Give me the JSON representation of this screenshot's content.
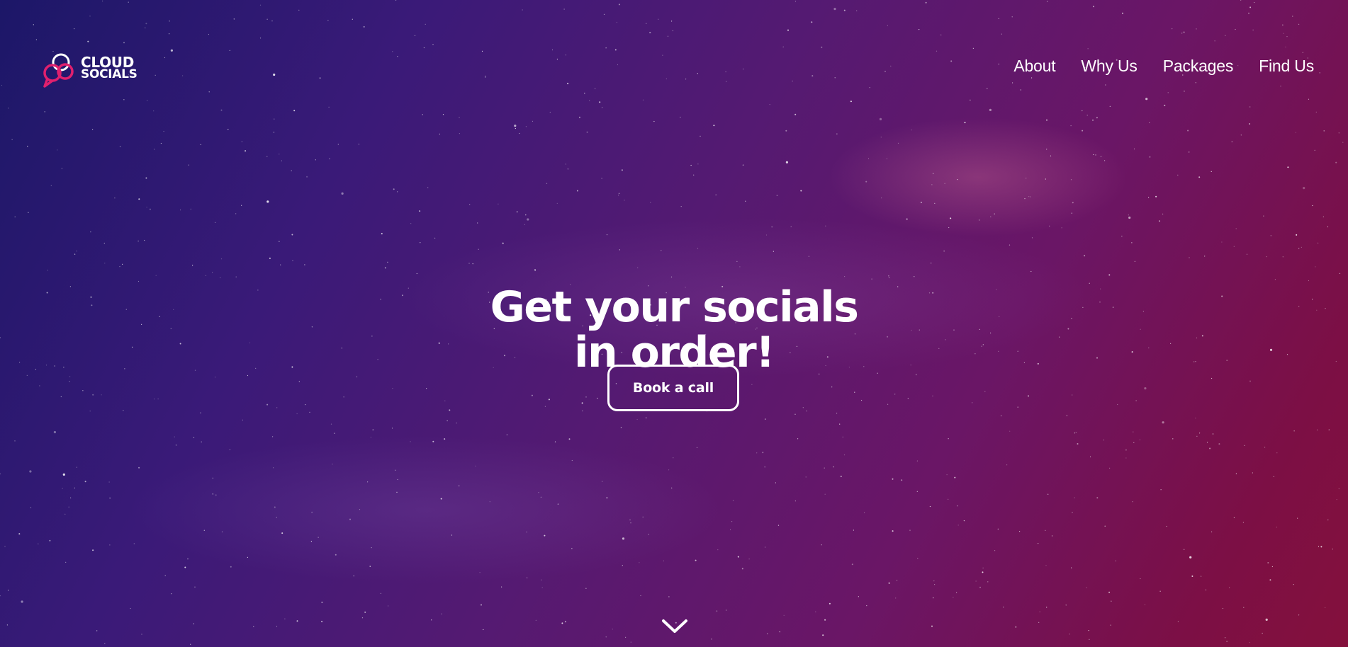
{
  "brand": {
    "line1": "CLOUD",
    "line2": "SOCIALS",
    "accent_color": "#e0206e"
  },
  "nav": {
    "items": [
      {
        "label": "About"
      },
      {
        "label": "Why Us"
      },
      {
        "label": "Packages"
      },
      {
        "label": "Find Us"
      }
    ]
  },
  "hero": {
    "headline_line1": "Get your socials",
    "headline_line2": "in order!",
    "cta_label": "Book a call",
    "scroll_icon": "chevron-down-icon",
    "background_colors": [
      "#1c1768",
      "#541a72",
      "#84103c"
    ]
  }
}
